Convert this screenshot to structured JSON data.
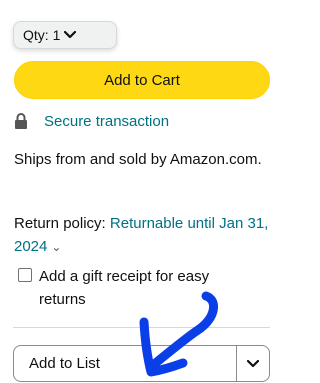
{
  "quantity": {
    "label": "Qty:",
    "value": "1"
  },
  "add_to_cart": {
    "label": "Add to Cart",
    "color": "#FFD814"
  },
  "secure": {
    "text": "Secure transaction"
  },
  "ships_sold": {
    "text": "Ships from and sold by Amazon.com."
  },
  "return_policy": {
    "label": "Return policy:",
    "link": "Returnable until Jan 31, 2024"
  },
  "gift_receipt": {
    "label": "Add a gift receipt for easy returns",
    "checked": false
  },
  "add_to_list": {
    "label": "Add to List"
  },
  "colors": {
    "link": "#007185",
    "annotation": "#0A3FE8"
  }
}
